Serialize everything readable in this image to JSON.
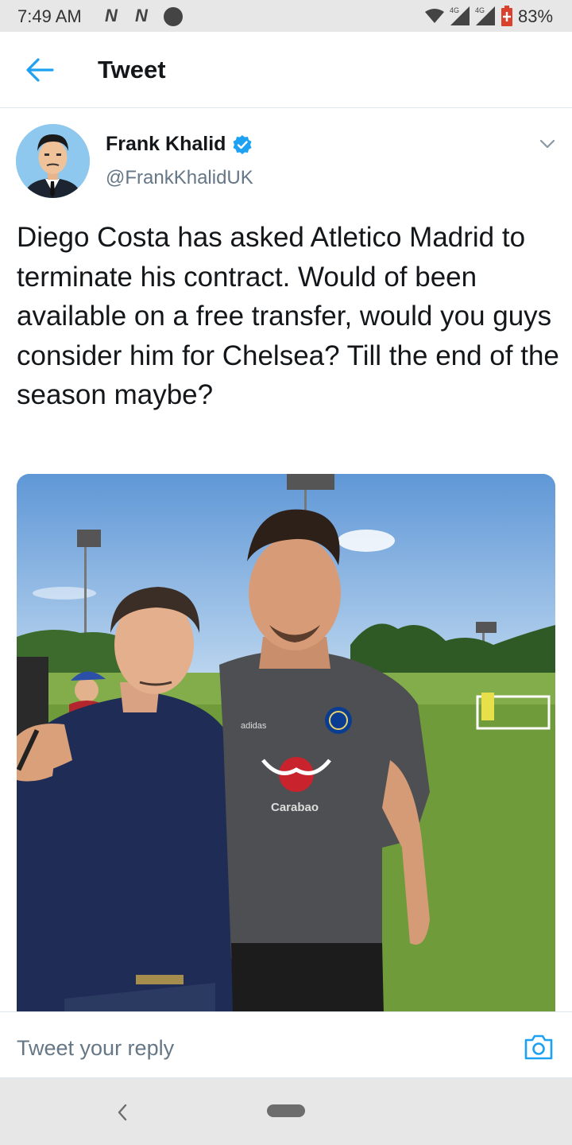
{
  "status_bar": {
    "time": "7:49 AM",
    "icon_1": "N",
    "icon_2": "N",
    "network_1": "4G",
    "network_2": "4G",
    "battery": "83%"
  },
  "header": {
    "title": "Tweet"
  },
  "tweet": {
    "author_name": "Frank Khalid",
    "handle": "@FrankKhalidUK",
    "text": "Diego Costa has asked Atletico Madrid to terminate his contract. Would of been available on a free transfer, would you guys consider him for Chelsea? Till the end of the season maybe?",
    "shirt_sponsor": "Carabao",
    "shirt_brand": "adidas"
  },
  "reply": {
    "placeholder": "Tweet your reply"
  },
  "colors": {
    "accent": "#1da1f2",
    "text_primary": "#14171a",
    "text_secondary": "#657786"
  },
  "icons": [
    "back-arrow-icon",
    "verified-badge-icon",
    "chevron-down-icon",
    "camera-icon",
    "wifi-icon",
    "signal-icon",
    "battery-icon",
    "nav-back-icon"
  ]
}
